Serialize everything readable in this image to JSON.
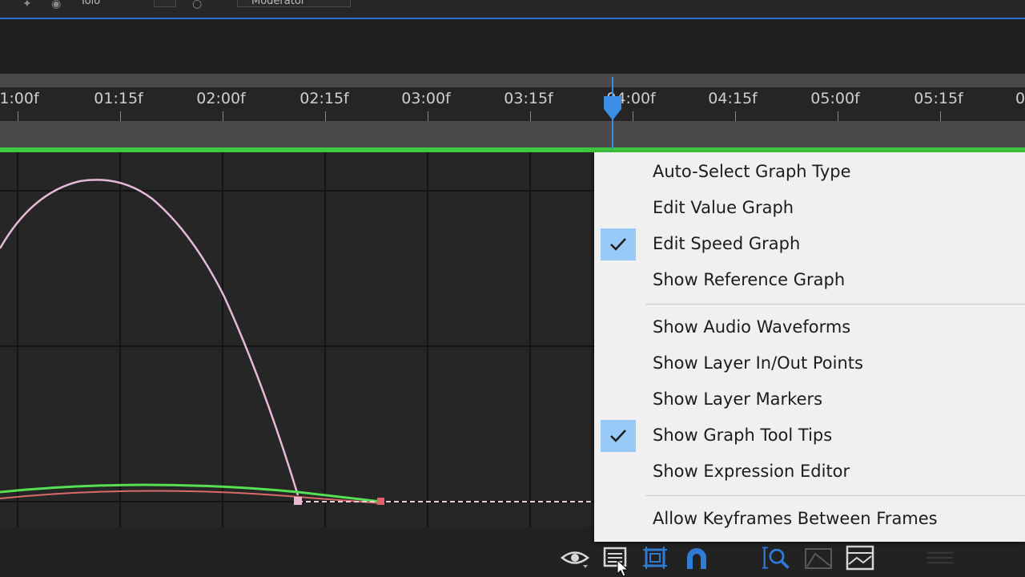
{
  "timeline": {
    "ruler_labels": [
      "1:00f",
      "01:15f",
      "02:00f",
      "02:15f",
      "03:00f",
      "03:15f",
      "04:00f",
      "04:15f",
      "05:00f",
      "05:15f",
      "0"
    ]
  },
  "top_bar": {
    "partial_text_1": "Tolo",
    "partial_text_2": "Moderator"
  },
  "context_menu": {
    "items": [
      {
        "label": "Auto-Select Graph Type",
        "checked": false
      },
      {
        "label": "Edit Value Graph",
        "checked": false
      },
      {
        "label": "Edit Speed Graph",
        "checked": true
      },
      {
        "label": "Show Reference Graph",
        "checked": false
      },
      {
        "label": "Show Audio Waveforms",
        "checked": false
      },
      {
        "label": "Show Layer In/Out Points",
        "checked": false
      },
      {
        "label": "Show Layer Markers",
        "checked": false
      },
      {
        "label": "Show Graph Tool Tips",
        "checked": true
      },
      {
        "label": "Show Expression Editor",
        "checked": false
      },
      {
        "label": "Allow Keyframes Between Frames",
        "checked": false
      }
    ]
  },
  "bottom_toolbar": {
    "buttons": [
      {
        "icon": "eye-icon"
      },
      {
        "icon": "properties-list-icon"
      },
      {
        "icon": "graph-bounds-icon"
      },
      {
        "icon": "snap-magnet-icon"
      },
      {
        "icon": "zoom-fit-icon"
      },
      {
        "icon": "auto-zoom-graph-icon"
      },
      {
        "icon": "fit-all-graphs-icon"
      }
    ]
  },
  "colors": {
    "workarea": "#3ec93e",
    "playhead": "#3a8ee6",
    "check_highlight": "#99c9f6",
    "value_curve": "#e7b8d8",
    "speed_curve_green": "#55e055",
    "speed_curve_red": "#d86a6a"
  }
}
